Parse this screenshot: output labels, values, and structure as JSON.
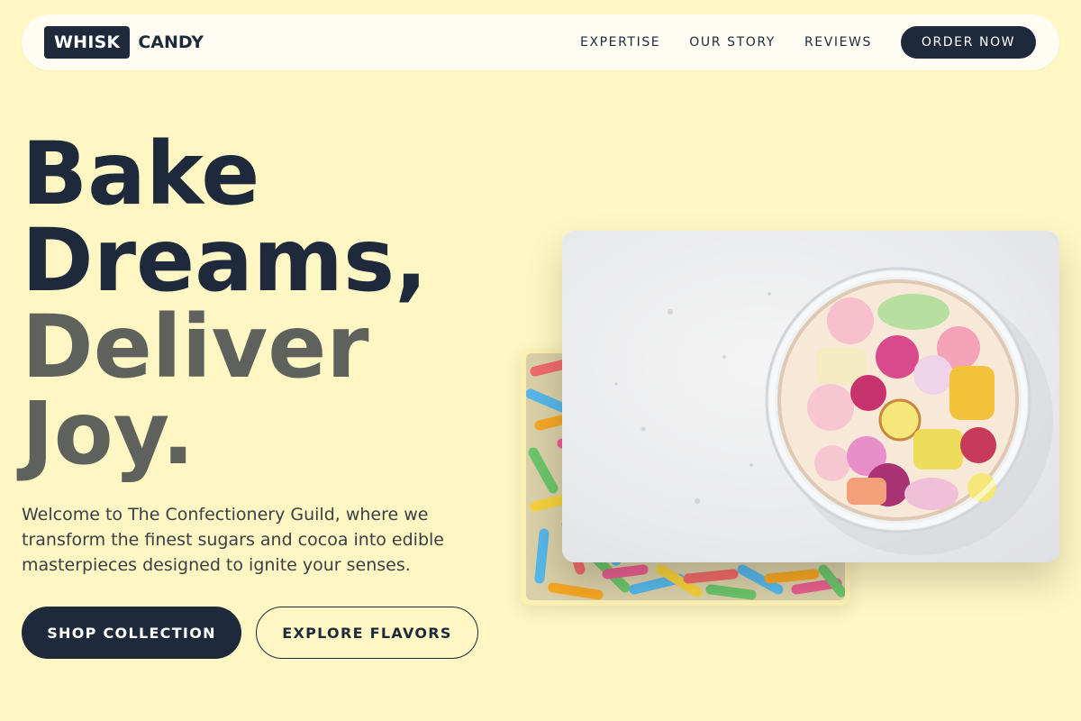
{
  "brand": {
    "logo_box": "WHISK",
    "logo_text": "CANDY",
    "colors": {
      "navy": "#1e293b",
      "background": "#fef7c3",
      "muted_heading": "#5f625c"
    }
  },
  "nav": {
    "links": [
      "EXPERTISE",
      "OUR STORY",
      "REVIEWS"
    ],
    "cta": "ORDER NOW"
  },
  "hero": {
    "headline_line1": "Bake",
    "headline_line2": "Dreams,",
    "headline_line3": "Deliver",
    "headline_line4": "Joy.",
    "intro": "Welcome to The Confectionery Guild, where we transform the finest sugars and cocoa into edible masterpieces designed to ignite your senses.",
    "primary_button": "SHOP COLLECTION",
    "secondary_button": "EXPLORE FLAVORS"
  },
  "images": {
    "back": "sour gummy worms photo",
    "front": "jar of hard candies on marble photo"
  }
}
